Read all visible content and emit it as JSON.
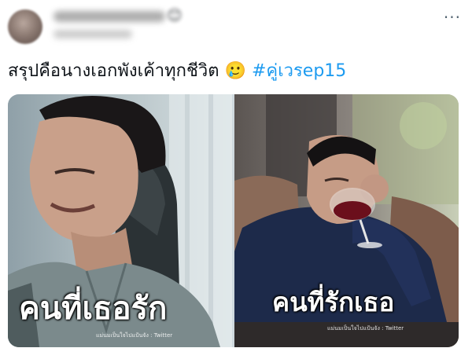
{
  "tweet": {
    "text_main": "สรุปคือนางเอกพังเค้าทุกชีวิต",
    "emoji": "🥲",
    "hashtag": "#คู่เวรep15"
  },
  "icons": {
    "more": "more-horizontal-icon",
    "emoji": "smiling-face-with-tear-icon"
  },
  "media": {
    "left": {
      "caption": "คนที่เธอรัก",
      "watermark": "แม่นมเป็นใจไปแป้นจัง : Twitter"
    },
    "right": {
      "caption": "คนที่รักเธอ",
      "watermark": "แม่นมเป็นใจไปแป้นจัง : Twitter"
    }
  },
  "colors": {
    "hashtag": "#1d9bf0",
    "text": "#0f1419",
    "icon": "#536471"
  }
}
